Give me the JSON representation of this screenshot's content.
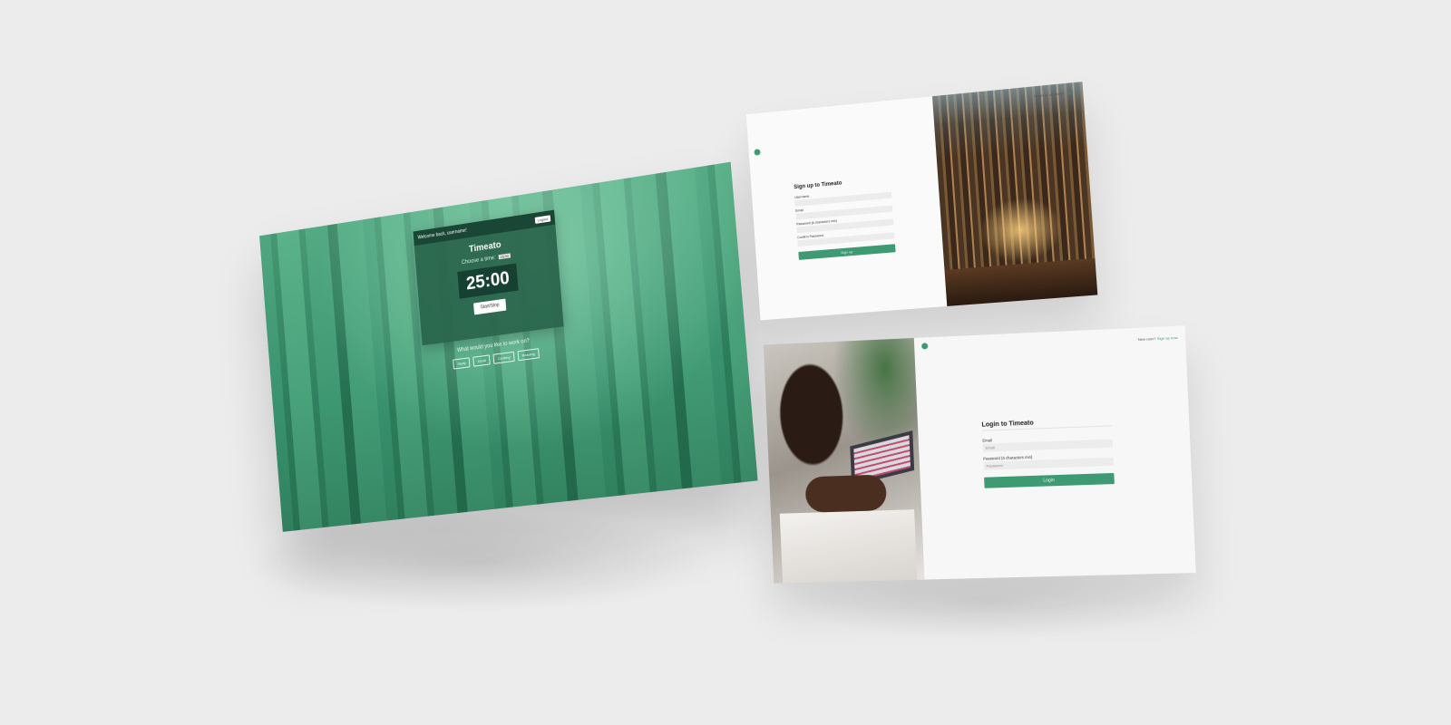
{
  "timer_screen": {
    "welcome": "Welcome back, username!",
    "logout": "Logout",
    "title": "Timeato",
    "choose_label": "Choose a time:",
    "select_value": "25:00",
    "clock": "25:00",
    "start_button": "Start/Stop",
    "question": "What would you like to work on?",
    "options": [
      "Study",
      "Email",
      "Cooking",
      "Reading"
    ],
    "colors": {
      "accent": "#3d9a72",
      "card": "#28644b"
    }
  },
  "signup_screen": {
    "top_link_text": "Have an account?",
    "top_link_action": "Log in",
    "form_title": "Sign up to Timeato",
    "fields": [
      {
        "label": "Username",
        "placeholder": ""
      },
      {
        "label": "Email",
        "placeholder": ""
      },
      {
        "label": "Password (6 characters min)",
        "placeholder": ""
      },
      {
        "label": "Confirm Password",
        "placeholder": ""
      }
    ],
    "submit": "Sign up"
  },
  "login_screen": {
    "top_link_text": "New user?",
    "top_link_action": "Sign up now",
    "form_title": "Login to Timeato",
    "fields": [
      {
        "label": "Email",
        "placeholder": "Email"
      },
      {
        "label": "Password (6 characters min)",
        "placeholder": "Password"
      }
    ],
    "submit": "Login"
  }
}
